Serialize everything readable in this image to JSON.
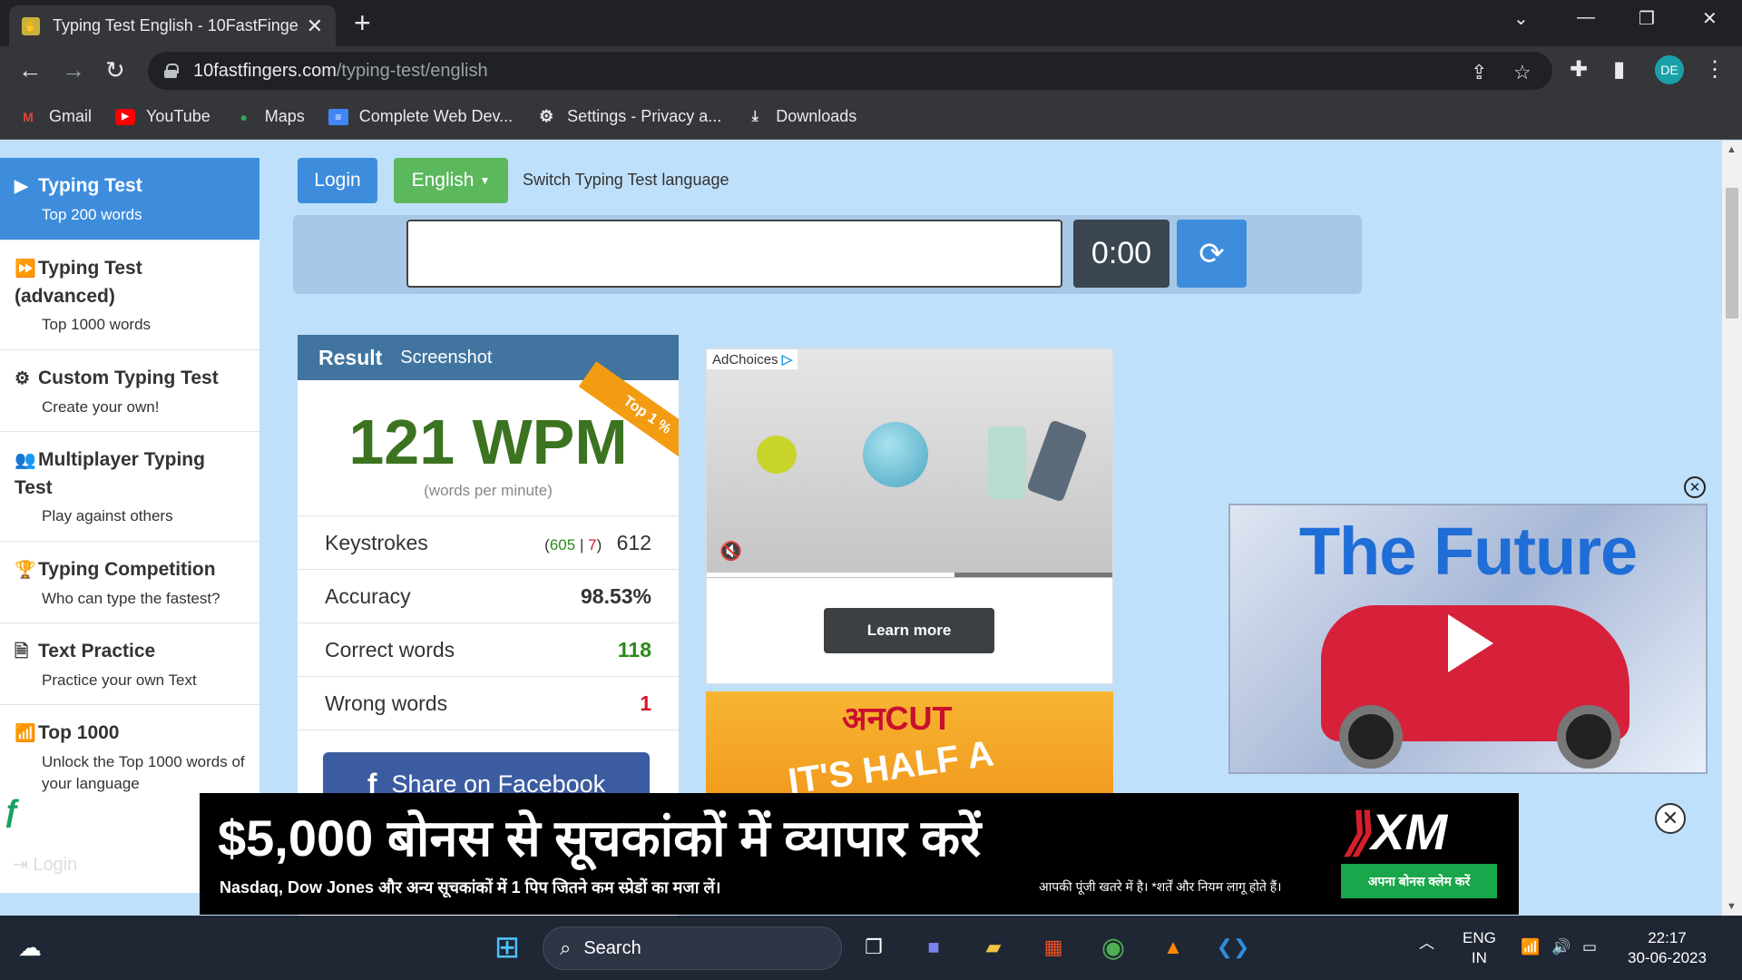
{
  "browser": {
    "tab_title": "Typing Test English - 10FastFinge",
    "url_host": "10fastfingers.com",
    "url_path": "/typing-test/english",
    "profile_initials": "DE",
    "bookmarks": [
      {
        "label": "Gmail",
        "icon": "gmail-icon"
      },
      {
        "label": "YouTube",
        "icon": "youtube-icon"
      },
      {
        "label": "Maps",
        "icon": "maps-icon"
      },
      {
        "label": "Complete Web Dev...",
        "icon": "docs-icon"
      },
      {
        "label": "Settings - Privacy a...",
        "icon": "gear-icon"
      },
      {
        "label": "Downloads",
        "icon": "download-icon"
      }
    ]
  },
  "sidebar": {
    "items": [
      {
        "title": "Typing Test",
        "sub": "Top 200 words",
        "icon": "play-icon",
        "active": true
      },
      {
        "title": "Typing Test (advanced)",
        "sub": "Top 1000 words",
        "icon": "fast-forward-icon"
      },
      {
        "title": "Custom Typing Test",
        "sub": "Create your own!",
        "icon": "cogs-icon"
      },
      {
        "title": "Multiplayer Typing Test",
        "sub": "Play against others",
        "icon": "users-icon"
      },
      {
        "title": "Typing Competition",
        "sub": "Who can type the fastest?",
        "icon": "trophy-icon"
      },
      {
        "title": "Text Practice",
        "sub": "Practice your own Text",
        "icon": "document-icon"
      },
      {
        "title": "Top 1000",
        "sub": "Unlock the Top 1000 words of your language",
        "icon": "signal-icon"
      }
    ],
    "login": "Login"
  },
  "toolbar": {
    "login": "Login",
    "language": "English",
    "switch_text": "Switch Typing Test language"
  },
  "test": {
    "timer": "0:00",
    "input_value": ""
  },
  "result": {
    "tab_result": "Result",
    "tab_screenshot": "Screenshot",
    "badge": "Top 1 %",
    "wpm": "121 WPM",
    "wpm_sub": "(words per minute)",
    "keystrokes_label": "Keystrokes",
    "keystrokes_correct": "605",
    "keystrokes_sep": "|",
    "keystrokes_wrong": "7",
    "keystrokes_total": "612",
    "accuracy_label": "Accuracy",
    "accuracy_value": "98.53%",
    "correct_label": "Correct words",
    "correct_value": "118",
    "wrong_label": "Wrong words",
    "wrong_value": "1",
    "share": "Share on Facebook"
  },
  "ads": {
    "adchoices": "AdChoices",
    "learn_more": "Learn more",
    "video_progress": 0.61,
    "uncut_brand": "अनCUT",
    "uncut_slogan": "IT'S HALF A",
    "future_title": "The Future",
    "banner_headline": "$5,000 बोनस से सूचकांकों में व्यापार करें",
    "banner_sub": "Nasdaq, Dow Jones और अन्य सूचकांकों में 1 पिप जितने कम स्प्रेडों का मजा लें।",
    "banner_risk": "आपकी पूंजी खतरे में है। *शर्तें और नियम लागू होते हैं।",
    "xm_logo": "XM",
    "xm_button": "अपना बोनस क्लेम करें"
  },
  "taskbar": {
    "search": "Search",
    "lang_top": "ENG",
    "lang_bottom": "IN",
    "time": "22:17",
    "date": "30-06-2023"
  }
}
